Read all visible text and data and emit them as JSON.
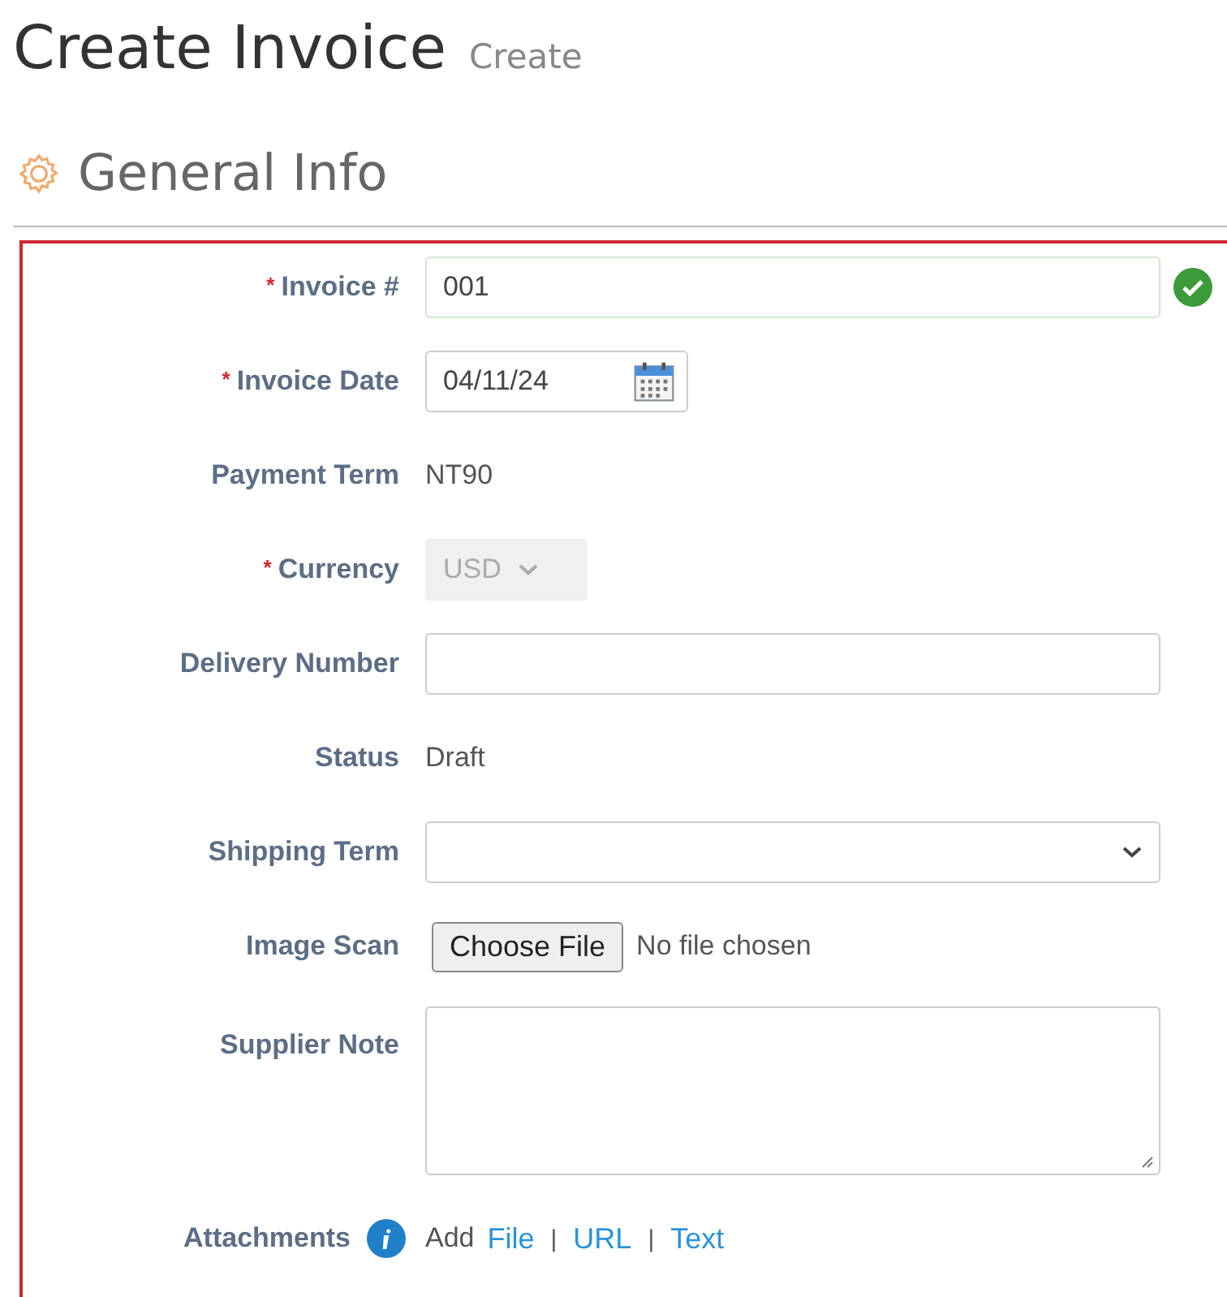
{
  "page": {
    "title": "Create Invoice",
    "subtitle": "Create"
  },
  "section": {
    "title": "General Info"
  },
  "fields": [
    {
      "kind": "text",
      "label": "Invoice #",
      "required_mark": "*",
      "value": "001",
      "valid": true
    },
    {
      "kind": "date",
      "label": "Invoice Date",
      "required_mark": "*",
      "value": "04/11/24"
    },
    {
      "kind": "static",
      "label": "Payment Term",
      "value": "NT90"
    },
    {
      "kind": "select",
      "label": "Currency",
      "required_mark": "*",
      "value": "USD",
      "disabled": true
    },
    {
      "kind": "text",
      "label": "Delivery Number",
      "valid": false
    },
    {
      "kind": "static",
      "label": "Status",
      "value": "Draft"
    },
    {
      "kind": "select",
      "label": "Shipping Term",
      "disabled": false
    },
    {
      "kind": "file",
      "label": "Image Scan",
      "button": "Choose File",
      "value": "No file chosen"
    },
    {
      "kind": "textarea",
      "label": "Supplier Note"
    },
    {
      "kind": "attachments",
      "label": "Attachments",
      "prefix": "Add",
      "separator": "|",
      "links": [
        "File",
        "URL",
        "Text"
      ]
    }
  ]
}
